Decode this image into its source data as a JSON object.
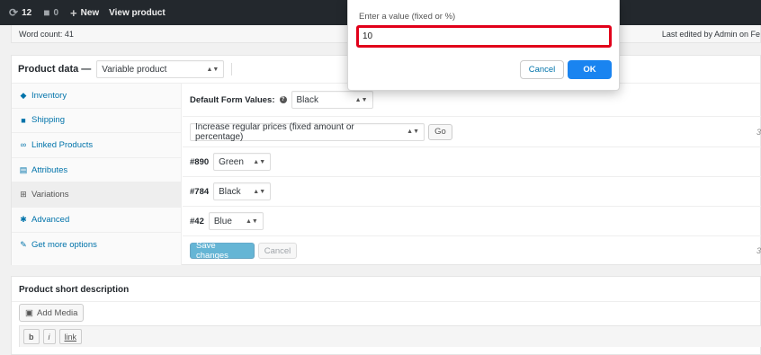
{
  "adminbar": {
    "updates_count": "12",
    "comments_count": "0",
    "new_label": "New",
    "view_label": "View product"
  },
  "editor_footer": {
    "word_count": "Word count: 41",
    "last_edited": "Last edited by Admin on Fe"
  },
  "product_data": {
    "title": "Product data —",
    "type_select": "Variable product",
    "tabs": [
      {
        "label": "Inventory",
        "icon": "inventory-icon"
      },
      {
        "label": "Shipping",
        "icon": "truck-icon"
      },
      {
        "label": "Linked Products",
        "icon": "link-icon"
      },
      {
        "label": "Attributes",
        "icon": "list-icon"
      },
      {
        "label": "Variations",
        "icon": "grid-icon",
        "active": true
      },
      {
        "label": "Advanced",
        "icon": "gear-icon"
      },
      {
        "label": "Get more options",
        "icon": "plugin-icon"
      }
    ],
    "default_form_values_label": "Default Form Values:",
    "default_value": "Black",
    "bulk_action": "Increase regular prices (fixed amount or percentage)",
    "go_label": "Go",
    "count_label_top": "3",
    "variations": [
      {
        "id": "#890",
        "value": "Green"
      },
      {
        "id": "#784",
        "value": "Black"
      },
      {
        "id": "#42",
        "value": "Blue"
      }
    ],
    "save_label": "Save changes",
    "cancel_label": "Cancel",
    "count_label_bottom": "3"
  },
  "short_description": {
    "title": "Product short description",
    "add_media_label": "Add Media",
    "toolbar": [
      "b",
      "i",
      "link"
    ]
  },
  "prompt_dialog": {
    "label": "Enter a value (fixed or %)",
    "value": "10",
    "cancel_label": "Cancel",
    "ok_label": "OK"
  },
  "colors": {
    "adminbar_bg": "#23282d",
    "link": "#0073aa",
    "primary": "#0085ba",
    "ok_button": "#1a84f0",
    "highlight_border": "#e1001a"
  }
}
